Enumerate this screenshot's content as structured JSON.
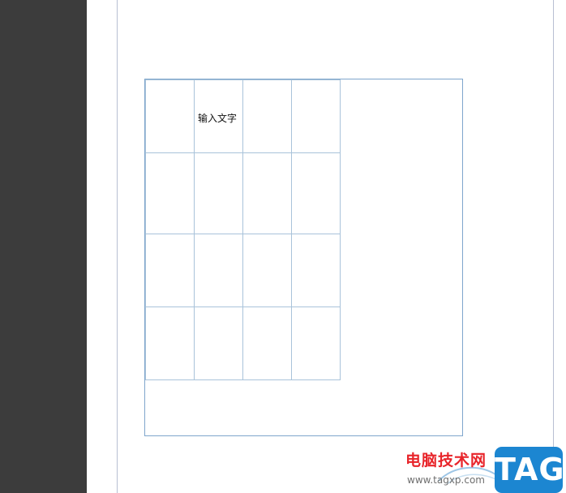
{
  "table": {
    "rows": [
      [
        "",
        "输入文字",
        "",
        ""
      ],
      [
        "",
        "",
        "",
        ""
      ],
      [
        "",
        "",
        "",
        ""
      ],
      [
        "",
        "",
        "",
        ""
      ]
    ]
  },
  "watermark": {
    "title": "电脑技术网",
    "badge": "TAG",
    "url": "www.tagxp.com",
    "title_color": "#e8242a",
    "badge_color": "#1c86d1"
  },
  "colors": {
    "left_panel": "#3c3c3c",
    "frame_border": "#7fa6cc",
    "cell_border": "#a9c3da"
  }
}
